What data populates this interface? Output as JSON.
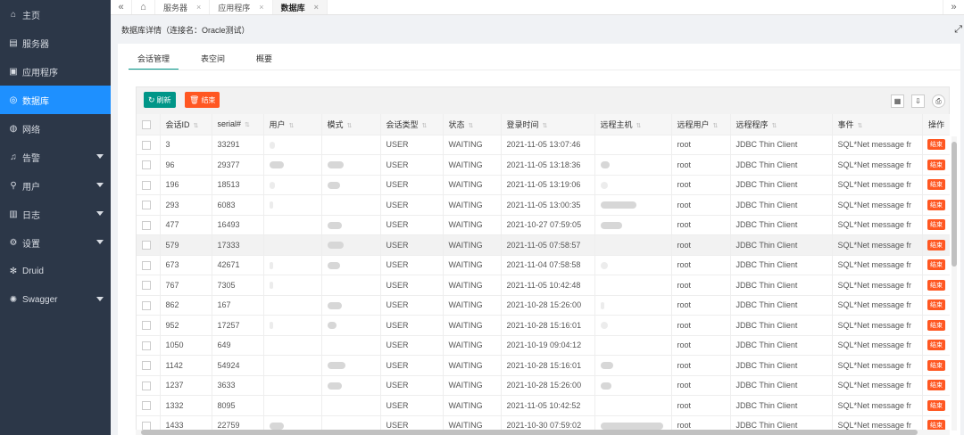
{
  "sidebar": {
    "items": [
      {
        "label": "主页",
        "icon": "⌂",
        "icon_name": "home-icon",
        "has_arrow": false
      },
      {
        "label": "服务器",
        "icon": "▤",
        "icon_name": "server-icon",
        "has_arrow": false
      },
      {
        "label": "应用程序",
        "icon": "▣",
        "icon_name": "app-icon",
        "has_arrow": false
      },
      {
        "label": "数据库",
        "icon": "◎",
        "icon_name": "database-icon",
        "has_arrow": false,
        "active": true
      },
      {
        "label": "网络",
        "icon": "◍",
        "icon_name": "network-icon",
        "has_arrow": false
      },
      {
        "label": "告警",
        "icon": "♫",
        "icon_name": "bell-icon",
        "has_arrow": true
      },
      {
        "label": "用户",
        "icon": "⚲",
        "icon_name": "user-icon",
        "has_arrow": true
      },
      {
        "label": "日志",
        "icon": "▥",
        "icon_name": "log-icon",
        "has_arrow": true
      },
      {
        "label": "设置",
        "icon": "⚙",
        "icon_name": "gear-icon",
        "has_arrow": true
      },
      {
        "label": "Druid",
        "icon": "✻",
        "icon_name": "druid-icon",
        "has_arrow": false
      },
      {
        "label": "Swagger",
        "icon": "✺",
        "icon_name": "swagger-icon",
        "has_arrow": true
      }
    ]
  },
  "topbar": {
    "collapse_icon": "«",
    "home_icon": "⌂",
    "tabs": [
      {
        "label": "服务器",
        "active": false
      },
      {
        "label": "应用程序",
        "active": false
      },
      {
        "label": "数据库",
        "active": true
      }
    ],
    "close_icon": "×",
    "more_icon": "»"
  },
  "page": {
    "title": "数据库详情（连接名：Oracle测试）",
    "expand_icon": "⤢"
  },
  "tabs": [
    "会话管理",
    "表空间",
    "概要"
  ],
  "toolbar": {
    "refresh_label": "刷新",
    "end_label": "结束",
    "refresh_icon": "↻",
    "end_icon": "🗑"
  },
  "table": {
    "columns": [
      "会话ID",
      "serial#",
      "用户",
      "模式",
      "会话类型",
      "状态",
      "登录时间",
      "远程主机",
      "远程用户",
      "远程程序",
      "事件",
      "操作"
    ],
    "end_button_label": "结束",
    "rows": [
      {
        "id": "3",
        "serial": "33291",
        "type": "USER",
        "status": "WAITING",
        "login": "2021-11-05 13:07:46",
        "ruser": "root",
        "prog": "JDBC Thin Client",
        "event": "SQL*Net message fr"
      },
      {
        "id": "96",
        "serial": "29377",
        "type": "USER",
        "status": "WAITING",
        "login": "2021-11-05 13:18:36",
        "ruser": "root",
        "prog": "JDBC Thin Client",
        "event": "SQL*Net message fr"
      },
      {
        "id": "196",
        "serial": "18513",
        "type": "USER",
        "status": "WAITING",
        "login": "2021-11-05 13:19:06",
        "ruser": "root",
        "prog": "JDBC Thin Client",
        "event": "SQL*Net message fr"
      },
      {
        "id": "293",
        "serial": "6083",
        "type": "USER",
        "status": "WAITING",
        "login": "2021-11-05 13:00:35",
        "ruser": "root",
        "prog": "JDBC Thin Client",
        "event": "SQL*Net message fr"
      },
      {
        "id": "477",
        "serial": "16493",
        "type": "USER",
        "status": "WAITING",
        "login": "2021-10-27 07:59:05",
        "ruser": "root",
        "prog": "JDBC Thin Client",
        "event": "SQL*Net message fr"
      },
      {
        "id": "579",
        "serial": "17333",
        "type": "USER",
        "status": "WAITING",
        "login": "2021-11-05 07:58:57",
        "ruser": "root",
        "prog": "JDBC Thin Client",
        "event": "SQL*Net message fr",
        "highlight": true
      },
      {
        "id": "673",
        "serial": "42671",
        "type": "USER",
        "status": "WAITING",
        "login": "2021-11-04 07:58:58",
        "ruser": "root",
        "prog": "JDBC Thin Client",
        "event": "SQL*Net message fr"
      },
      {
        "id": "767",
        "serial": "7305",
        "type": "USER",
        "status": "WAITING",
        "login": "2021-11-05 10:42:48",
        "ruser": "root",
        "prog": "JDBC Thin Client",
        "event": "SQL*Net message fr"
      },
      {
        "id": "862",
        "serial": "167",
        "type": "USER",
        "status": "WAITING",
        "login": "2021-10-28 15:26:00",
        "ruser": "root",
        "prog": "JDBC Thin Client",
        "event": "SQL*Net message fr"
      },
      {
        "id": "952",
        "serial": "17257",
        "type": "USER",
        "status": "WAITING",
        "login": "2021-10-28 15:16:01",
        "ruser": "root",
        "prog": "JDBC Thin Client",
        "event": "SQL*Net message fr"
      },
      {
        "id": "1050",
        "serial": "649",
        "type": "USER",
        "status": "WAITING",
        "login": "2021-10-19 09:04:12",
        "ruser": "root",
        "prog": "JDBC Thin Client",
        "event": "SQL*Net message fr"
      },
      {
        "id": "1142",
        "serial": "54924",
        "type": "USER",
        "status": "WAITING",
        "login": "2021-10-28 15:16:01",
        "ruser": "root",
        "prog": "JDBC Thin Client",
        "event": "SQL*Net message fr"
      },
      {
        "id": "1237",
        "serial": "3633",
        "type": "USER",
        "status": "WAITING",
        "login": "2021-10-28 15:26:00",
        "ruser": "root",
        "prog": "JDBC Thin Client",
        "event": "SQL*Net message fr"
      },
      {
        "id": "1332",
        "serial": "8095",
        "type": "USER",
        "status": "WAITING",
        "login": "2021-11-05 10:42:52",
        "ruser": "root",
        "prog": "JDBC Thin Client",
        "event": "SQL*Net message fr"
      },
      {
        "id": "1433",
        "serial": "22759",
        "type": "USER",
        "status": "WAITING",
        "login": "2021-10-30 07:59:02",
        "ruser": "root",
        "prog": "JDBC Thin Client",
        "event": "SQL*Net message fr"
      }
    ]
  },
  "colors": {
    "sidebar_bg": "#2c3748",
    "active": "#1e90ff",
    "refresh": "#009688",
    "end": "#ff5722"
  }
}
